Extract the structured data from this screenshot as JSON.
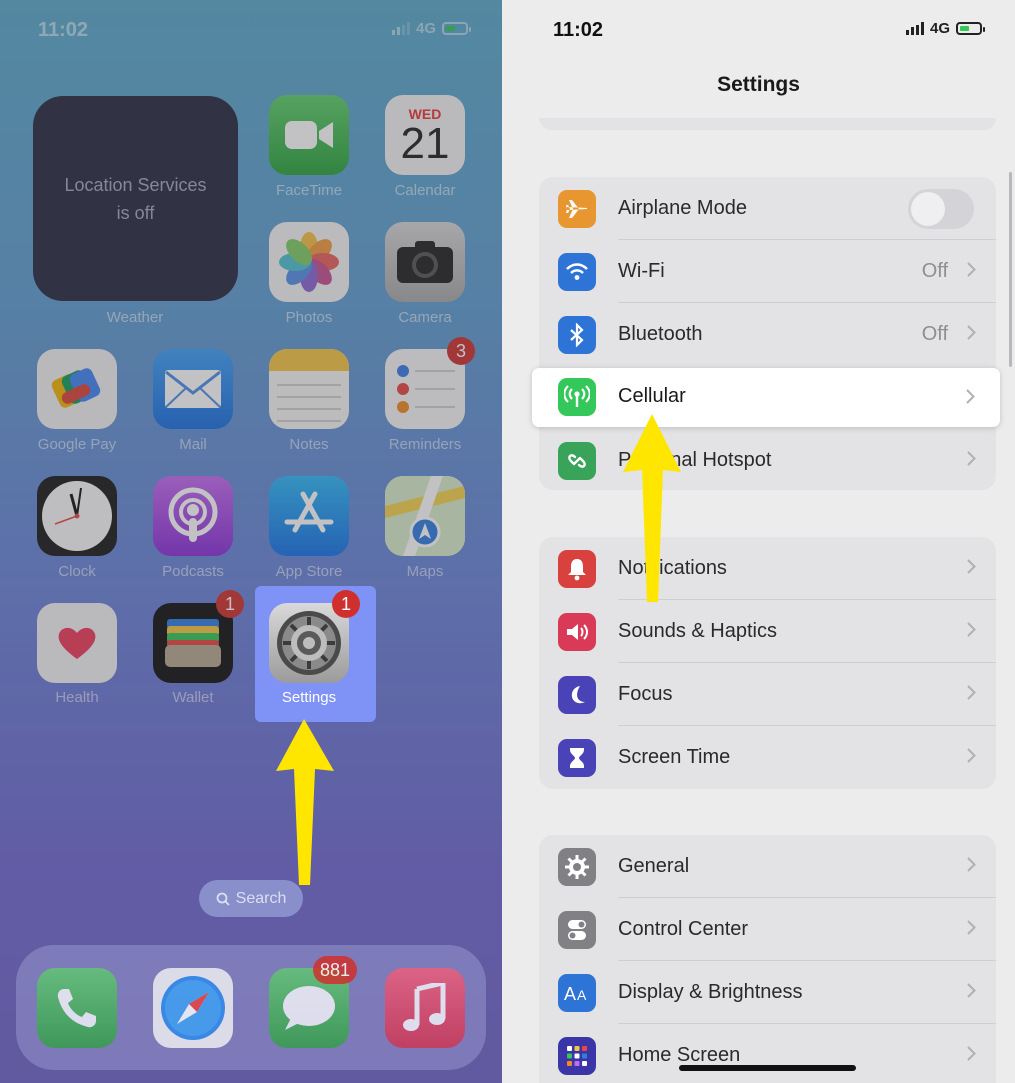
{
  "home": {
    "status": {
      "time": "11:02",
      "network": "4G"
    },
    "widget": {
      "line1": "Location Services",
      "line2": "is off",
      "label": "Weather"
    },
    "calendar": {
      "weekday": "WED",
      "day": "21"
    },
    "apps": {
      "facetime": "FaceTime",
      "calendar": "Calendar",
      "photos": "Photos",
      "camera": "Camera",
      "googlepay": "Google Pay",
      "mail": "Mail",
      "notes": "Notes",
      "reminders": "Reminders",
      "clock": "Clock",
      "podcasts": "Podcasts",
      "appstore": "App Store",
      "maps": "Maps",
      "health": "Health",
      "wallet": "Wallet",
      "settings": "Settings"
    },
    "badges": {
      "reminders": "3",
      "wallet": "1",
      "settings": "1",
      "messages": "881"
    },
    "search_label": "Search",
    "dock": [
      "Phone",
      "Safari",
      "Messages",
      "Music"
    ]
  },
  "settings": {
    "status": {
      "time": "11:02",
      "network": "4G"
    },
    "title": "Settings",
    "rows": {
      "airplane": "Airplane Mode",
      "wifi": "Wi-Fi",
      "wifi_value": "Off",
      "bluetooth": "Bluetooth",
      "bluetooth_value": "Off",
      "cellular": "Cellular",
      "hotspot": "Personal Hotspot",
      "notifications": "Notifications",
      "sounds": "Sounds & Haptics",
      "focus": "Focus",
      "screentime": "Screen Time",
      "general": "General",
      "controlcenter": "Control Center",
      "display": "Display & Brightness",
      "homescreen": "Home Screen"
    }
  },
  "colors": {
    "arrow": "#ffe600",
    "highlight": "#7e93f5",
    "cellular_green": "#34c759",
    "badge_red": "#d0302d"
  },
  "icons": [
    "airplane-icon",
    "wifi-icon",
    "bluetooth-icon",
    "antenna-icon",
    "hotspot-icon",
    "bell-icon",
    "speaker-icon",
    "moon-icon",
    "hourglass-icon",
    "gear-icon",
    "toggles-icon",
    "aa-icon",
    "grid-icon"
  ]
}
